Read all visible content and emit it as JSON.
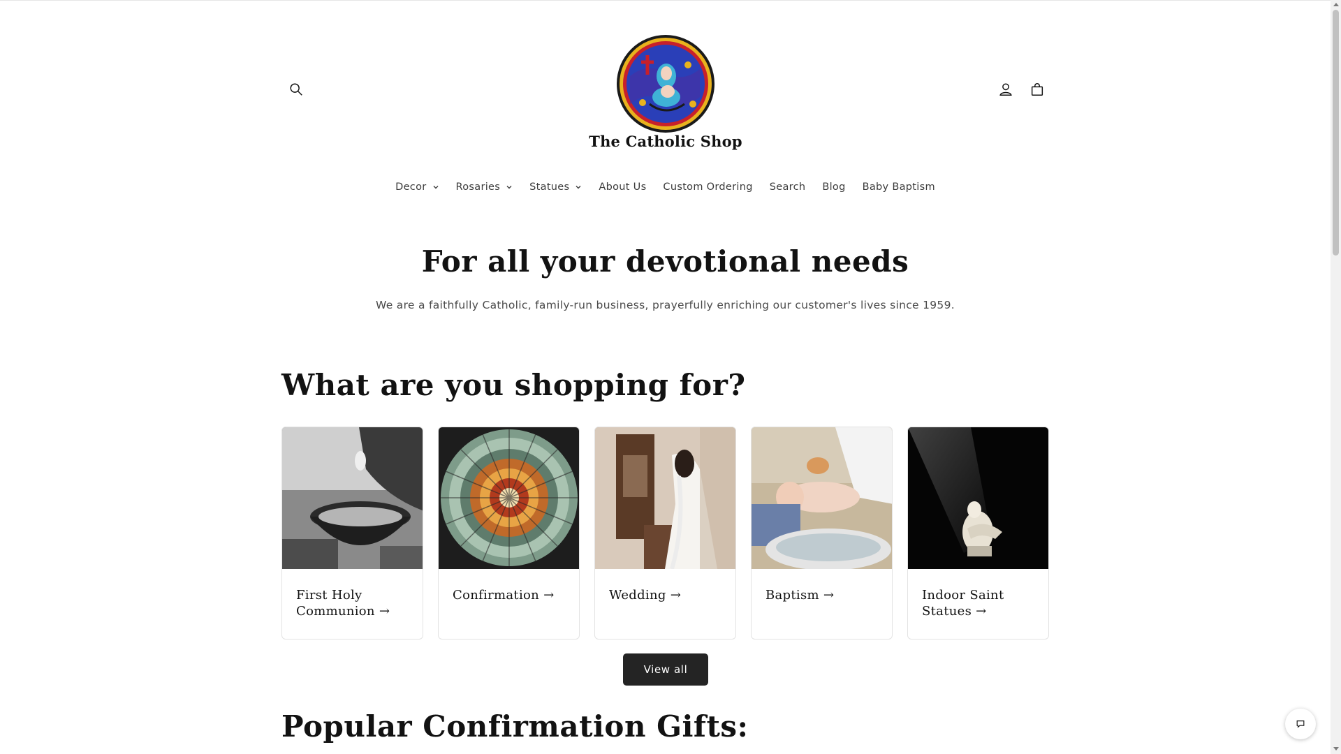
{
  "header": {
    "brand": "The Catholic Shop",
    "icons": {
      "search": "search-icon",
      "account": "account-icon",
      "cart": "cart-icon"
    }
  },
  "nav": {
    "items": [
      {
        "label": "Decor",
        "dropdown": true
      },
      {
        "label": "Rosaries",
        "dropdown": true
      },
      {
        "label": "Statues",
        "dropdown": true
      },
      {
        "label": "About Us",
        "dropdown": false
      },
      {
        "label": "Custom Ordering",
        "dropdown": false
      },
      {
        "label": "Search",
        "dropdown": false
      },
      {
        "label": "Blog",
        "dropdown": false
      },
      {
        "label": "Baby Baptism",
        "dropdown": false
      }
    ]
  },
  "hero": {
    "title": "For all your devotional needs",
    "subtitle": "We are a faithfully Catholic, family-run business, prayerfully enriching our customer's lives since 1959."
  },
  "collections": {
    "title": "What are you shopping for?",
    "cards": [
      {
        "label": "First Holy Communion →"
      },
      {
        "label": "Confirmation →"
      },
      {
        "label": "Wedding →"
      },
      {
        "label": "Baptism →"
      },
      {
        "label": "Indoor Saint Statues →"
      }
    ],
    "view_all": "View all"
  },
  "popular": {
    "title": "Popular Confirmation Gifts:"
  },
  "colors": {
    "text": "#121212",
    "button_bg": "#242424",
    "border": "#e3e3e3"
  }
}
